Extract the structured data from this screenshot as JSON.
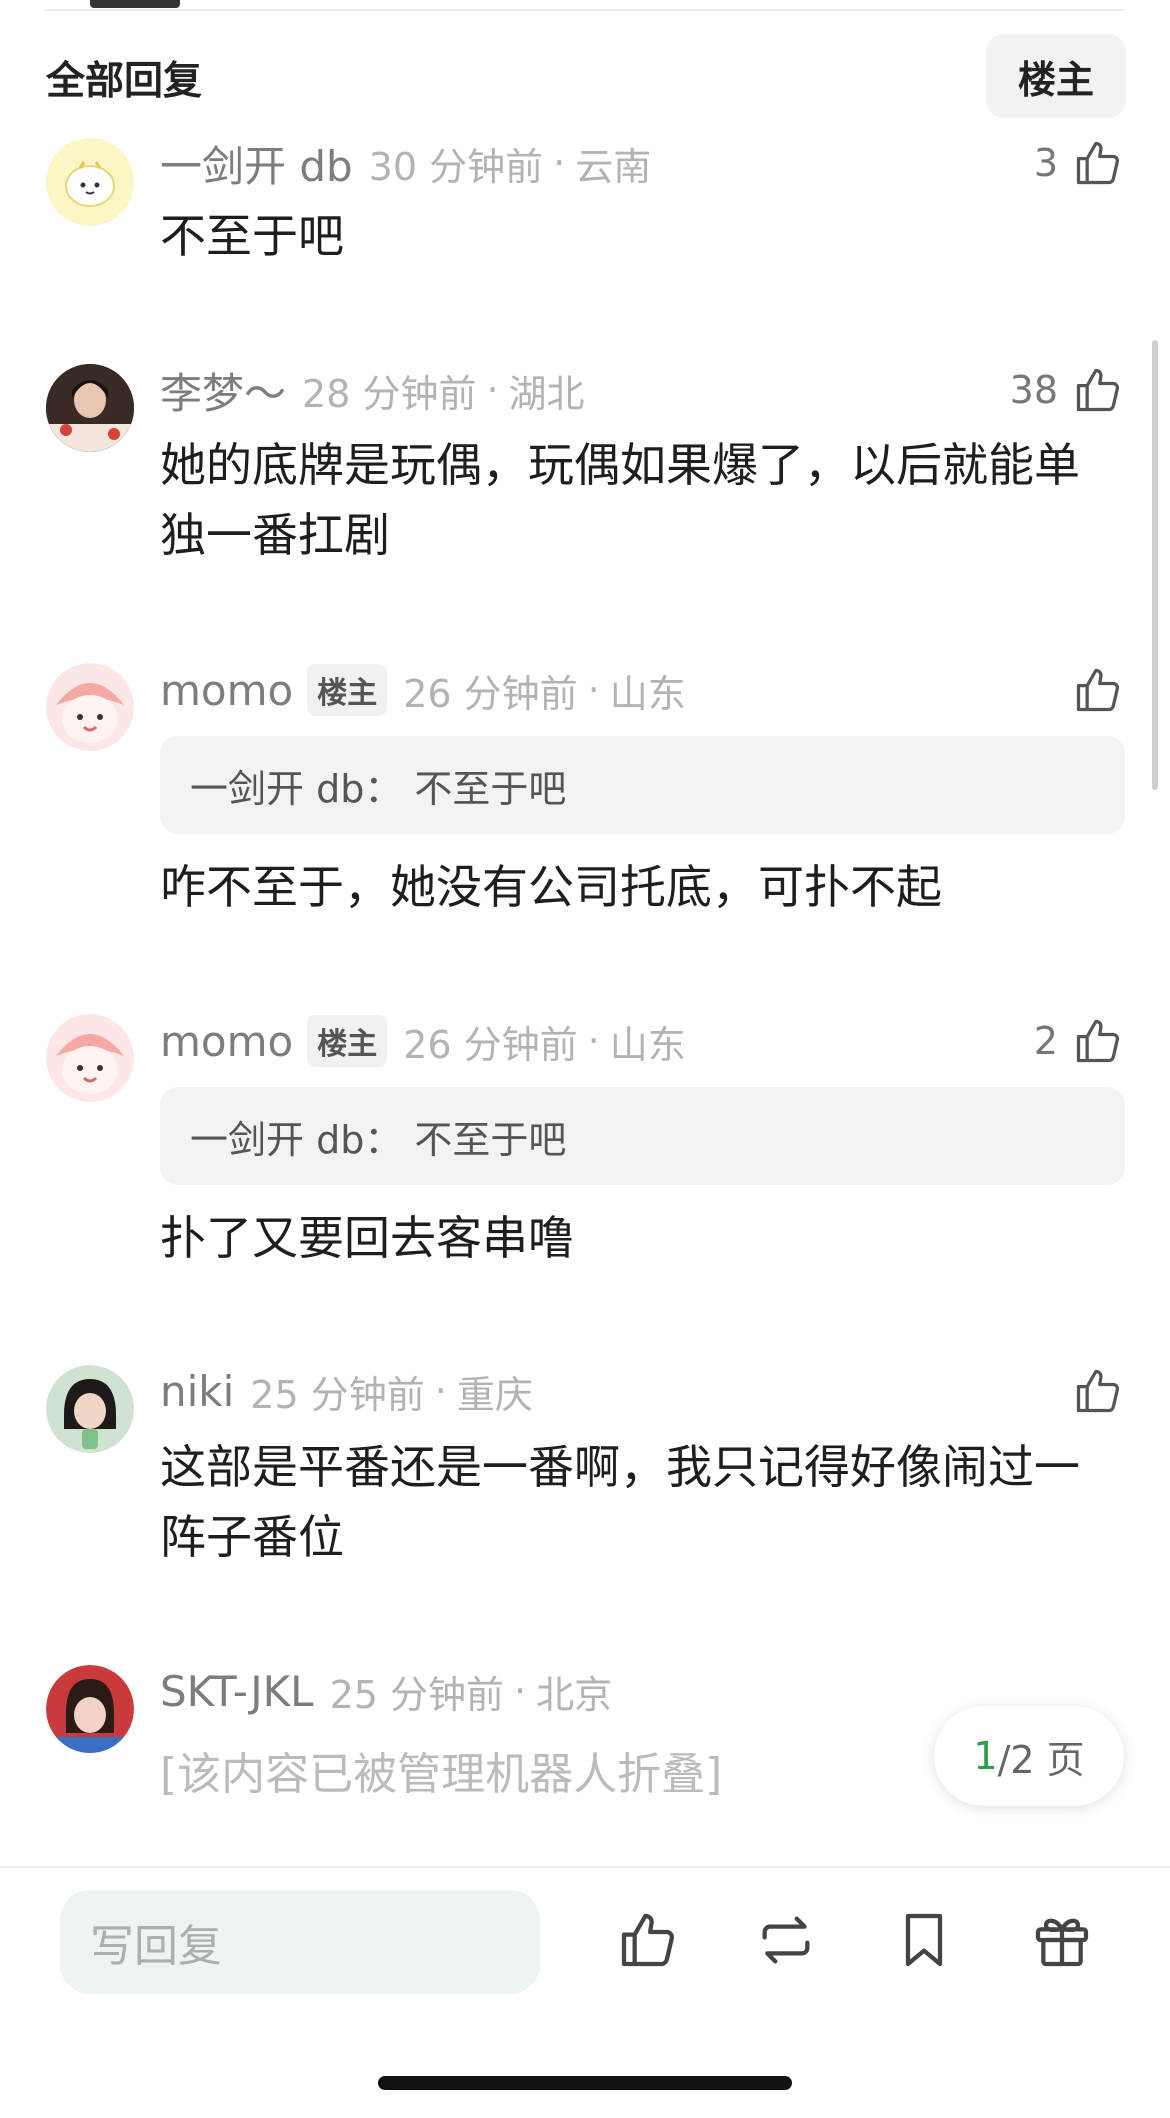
{
  "header": {
    "title": "全部回复",
    "op_filter_label": "楼主"
  },
  "comments": [
    {
      "username": "一剑开 db",
      "time": "30 分钟前",
      "location": "云南",
      "likes": "3",
      "text": "不至于吧"
    },
    {
      "username": "李梦～",
      "time": "28 分钟前",
      "location": "湖北",
      "likes": "38",
      "text": "她的底牌是玩偶，玩偶如果爆了，以后就能单独一番扛剧"
    },
    {
      "username": "momo",
      "badge": "楼主",
      "time": "26 分钟前",
      "location": "山东",
      "likes": "",
      "quote": "一剑开 db：  不至于吧",
      "text": "咋不至于，她没有公司托底，可扑不起"
    },
    {
      "username": "momo",
      "badge": "楼主",
      "time": "26 分钟前",
      "location": "山东",
      "likes": "2",
      "quote": "一剑开 db：  不至于吧",
      "text": "扑了又要回去客串噜"
    },
    {
      "username": "niki",
      "time": "25 分钟前",
      "location": "重庆",
      "likes": "",
      "text": "这部是平番还是一番啊，我只记得好像闹过一阵子番位"
    },
    {
      "username": "SKT-JKL",
      "time": "25 分钟前",
      "location": "北京",
      "text": "[该内容已被管理机器人折叠]"
    }
  ],
  "pagination": {
    "current": "1",
    "total": "/2 页"
  },
  "bottom_bar": {
    "reply_placeholder": "写回复"
  },
  "colors": {
    "accent": "#2e9e4a",
    "meta": "#b3b3b3"
  },
  "icons": [
    "thumbs-up-icon",
    "repost-icon",
    "bookmark-icon",
    "gift-icon"
  ]
}
